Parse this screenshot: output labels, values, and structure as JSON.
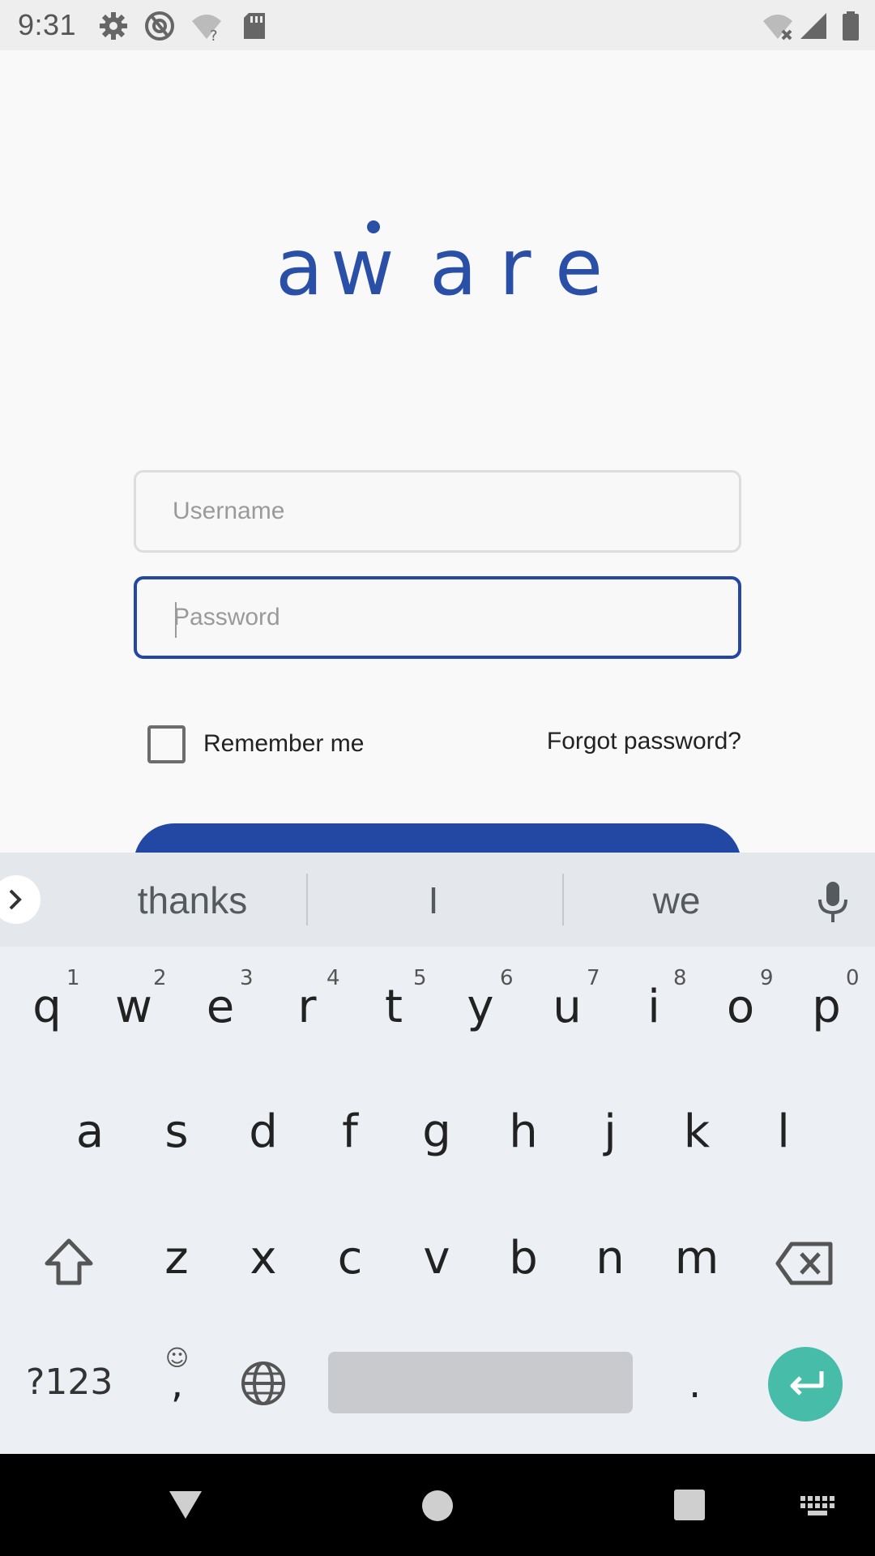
{
  "status_bar": {
    "time": "9:31",
    "left_icons": [
      "gear-icon",
      "at-sign-icon",
      "wifi-question-icon",
      "sd-card-icon"
    ],
    "right_icons": [
      "wifi-off-icon",
      "signal-icon",
      "battery-icon"
    ]
  },
  "app": {
    "logo_text": "aware",
    "username_placeholder": "Username",
    "password_placeholder": "Password",
    "remember_label": "Remember me",
    "forgot_label": "Forgot password?",
    "login_button_label": "",
    "brand_color": "#2248a4"
  },
  "keyboard": {
    "suggestions": [
      "thanks",
      "I",
      "we"
    ],
    "row1": [
      "q",
      "w",
      "e",
      "r",
      "t",
      "y",
      "u",
      "i",
      "o",
      "p"
    ],
    "row1_hints": [
      "1",
      "2",
      "3",
      "4",
      "5",
      "6",
      "7",
      "8",
      "9",
      "0"
    ],
    "row2": [
      "a",
      "s",
      "d",
      "f",
      "g",
      "h",
      "j",
      "k",
      "l"
    ],
    "row3": [
      "z",
      "x",
      "c",
      "v",
      "b",
      "n",
      "m"
    ],
    "symbols_label": "?123",
    "comma_label": ",",
    "emoji_hint": "☺",
    "period_label": ".",
    "enter_color": "#46bca9"
  },
  "nav_bar": {
    "icons": [
      "back-icon",
      "home-icon",
      "recents-icon",
      "keyboard-switch-icon"
    ]
  }
}
